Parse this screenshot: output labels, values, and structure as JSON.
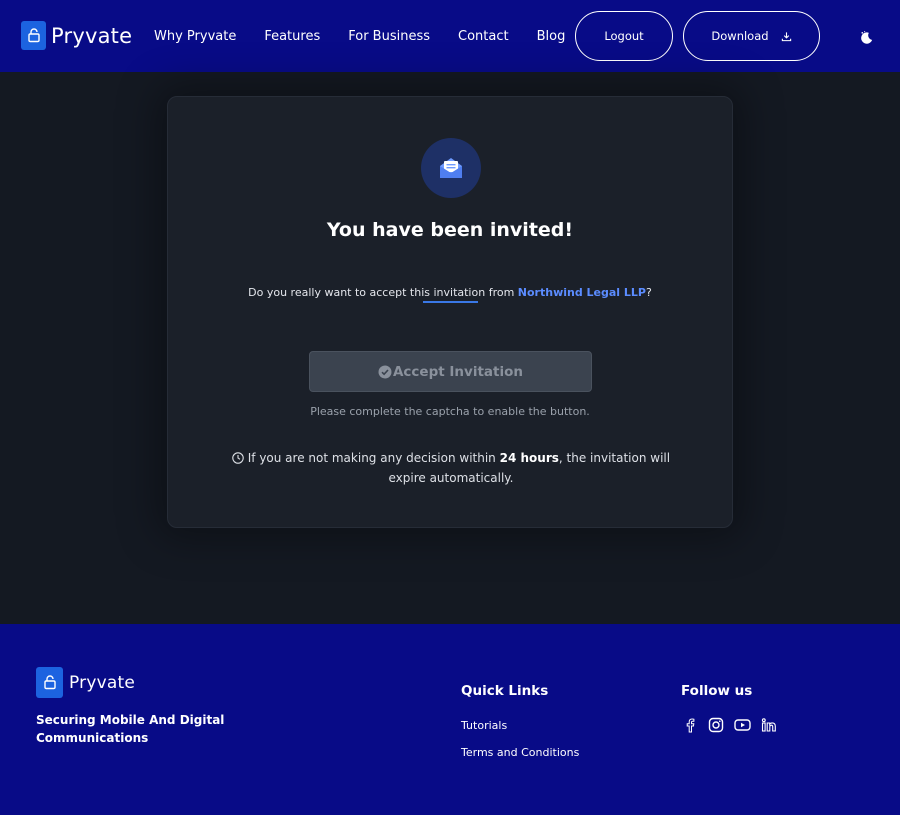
{
  "header": {
    "brand_name": "Pryvate",
    "nav": [
      "Why Pryvate",
      "Features",
      "For Business",
      "Contact",
      "Blog"
    ],
    "logout_label": "Logout",
    "download_label": "Download",
    "icons": {
      "logo": "lock-icon",
      "download": "download-icon",
      "theme": "moon-icon"
    }
  },
  "invitation": {
    "title": "You have been invited!",
    "question_prefix": "Do you really want to accept this invitation from ",
    "organization": "Northwind Legal LLP",
    "question_suffix": "?",
    "accept_label": "Accept Invitation",
    "accept_enabled": false,
    "captcha_note": "Please complete the captcha to enable the button.",
    "expire_prefix": " If you are not making any decision within ",
    "expire_hours": "24 hours",
    "expire_suffix": ", the invitation will expire automatically.",
    "icons": {
      "envelope": "envelope-open-icon",
      "check": "check-circle-icon",
      "clock": "clock-icon"
    }
  },
  "footer": {
    "brand_name": "Pryvate",
    "tagline": "Securing Mobile And Digital Communications",
    "quick_links_title": "Quick Links",
    "quick_links": [
      "Tutorials",
      "Terms and Conditions"
    ],
    "follow_title": "Follow us",
    "social": [
      "facebook-icon",
      "instagram-icon",
      "youtube-icon",
      "linkedin-icon"
    ]
  },
  "colors": {
    "header_bg": "#080b87",
    "page_bg": "#141922",
    "card_bg": "#1b2029",
    "accent": "#5b8cff",
    "logo_bg": "#1c63e0"
  }
}
